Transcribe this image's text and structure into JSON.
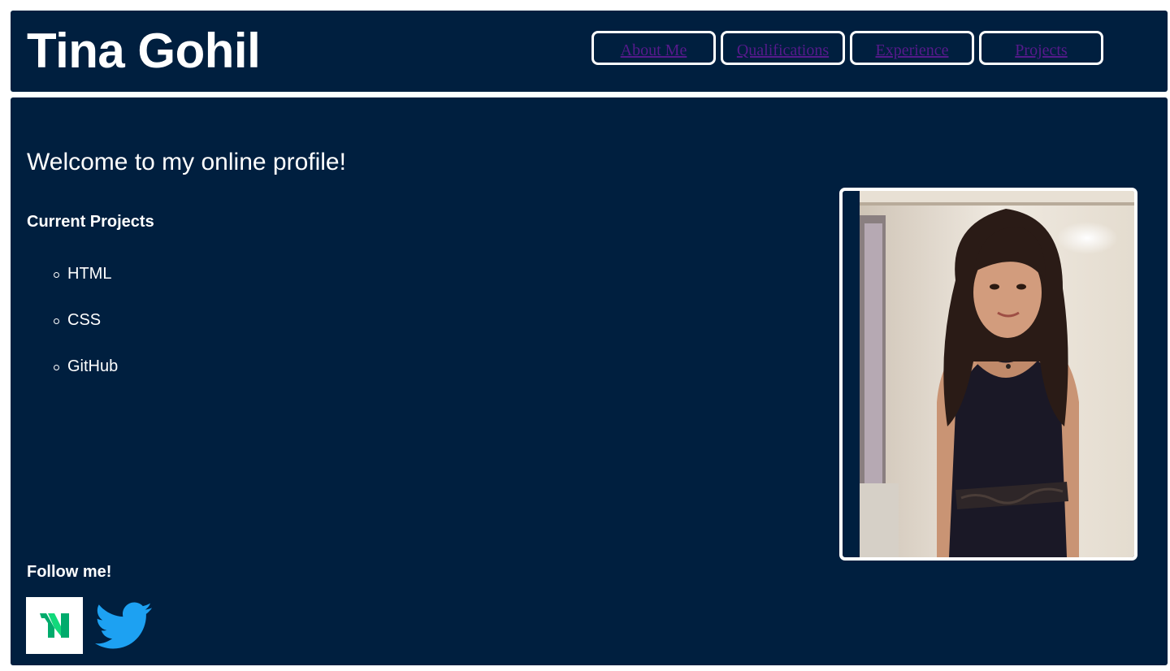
{
  "header": {
    "title": "Tina Gohil",
    "nav": [
      {
        "label": "About Me"
      },
      {
        "label": "Qualifications"
      },
      {
        "label": "Experience"
      },
      {
        "label": "Projects"
      }
    ]
  },
  "main": {
    "welcome": "Welcome to my online profile!",
    "projects_heading": "Current Projects",
    "projects": [
      "HTML",
      "CSS",
      "GitHub"
    ],
    "follow_heading": "Follow me!",
    "social": [
      {
        "icon": "medium-icon"
      },
      {
        "icon": "twitter-icon"
      }
    ]
  },
  "colors": {
    "panel_background": "#001f3f",
    "text": "#ffffff",
    "link": "#551a8b",
    "twitter_blue": "#1da1f2",
    "medium_green": "#00ab6c"
  }
}
